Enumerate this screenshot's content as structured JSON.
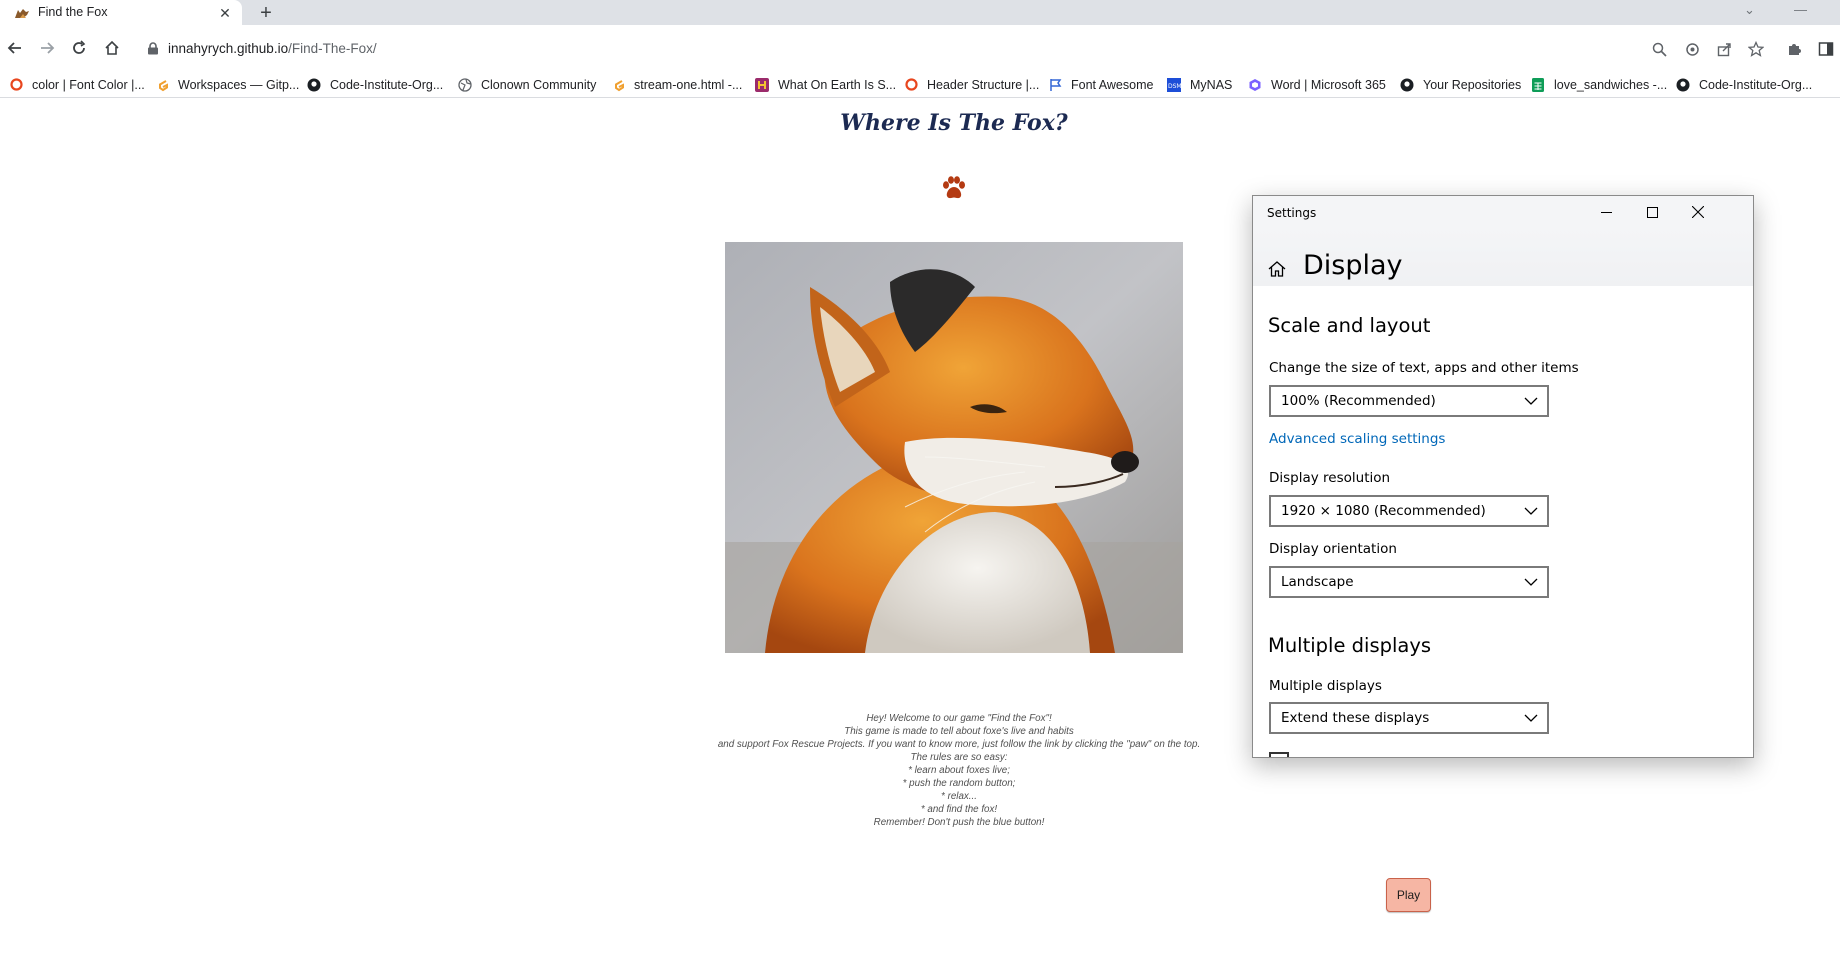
{
  "browser": {
    "tab": {
      "title": "Find the Fox"
    },
    "url": {
      "host": "innahyrych.github.io",
      "path": "/Find-The-Fox/"
    },
    "bookmarks": [
      {
        "label": "color | Font Color |...",
        "icon": "circle-icon"
      },
      {
        "label": "Workspaces — Gitp...",
        "icon": "gitpod-icon"
      },
      {
        "label": "Code-Institute-Org...",
        "icon": "github-icon"
      },
      {
        "label": "Clonown Community",
        "icon": "globe-icon"
      },
      {
        "label": "stream-one.html -...",
        "icon": "gitpod-icon"
      },
      {
        "label": "What On Earth Is S...",
        "icon": "h-icon"
      },
      {
        "label": "Header Structure |...",
        "icon": "circle-icon"
      },
      {
        "label": "Font Awesome",
        "icon": "flag-icon"
      },
      {
        "label": "MyNAS",
        "icon": "dsm-icon"
      },
      {
        "label": "Word | Microsoft 365",
        "icon": "office-icon"
      },
      {
        "label": "Your Repositories",
        "icon": "github-icon"
      },
      {
        "label": "love_sandwiches -...",
        "icon": "sheets-icon"
      },
      {
        "label": "Code-Institute-Org...",
        "icon": "github-icon"
      }
    ]
  },
  "page": {
    "title": "Where Is The Fox?",
    "rules": [
      "Hey! Welcome to our game \"Find the Fox\"!",
      "This game is made to tell about foxe's live and habits",
      "and support Fox Rescue Projects. If you want to know more, just follow the link by clicking the \"paw\" on the top.",
      "The rules are so easy:",
      "* learn about foxes live;",
      "* push the random button;",
      "* relax...",
      "* and find the fox!",
      "Remember! Don't push the blue button!"
    ],
    "play_label": "Play"
  },
  "settings": {
    "window_title": "Settings",
    "page_title": "Display",
    "scale_heading": "Scale and layout",
    "size_label": "Change the size of text, apps and other items",
    "size_value": "100% (Recommended)",
    "advanced_link": "Advanced scaling settings",
    "resolution_label": "Display resolution",
    "resolution_value": "1920 × 1080 (Recommended)",
    "orientation_label": "Display orientation",
    "orientation_value": "Landscape",
    "multi_heading": "Multiple displays",
    "multi_label": "Multiple displays",
    "multi_value": "Extend these displays"
  },
  "colors": {
    "title_navy": "#1c2a52",
    "paw_rust": "#b43a12",
    "play_bg": "#f6b6a4",
    "link_blue": "#0067b8"
  }
}
